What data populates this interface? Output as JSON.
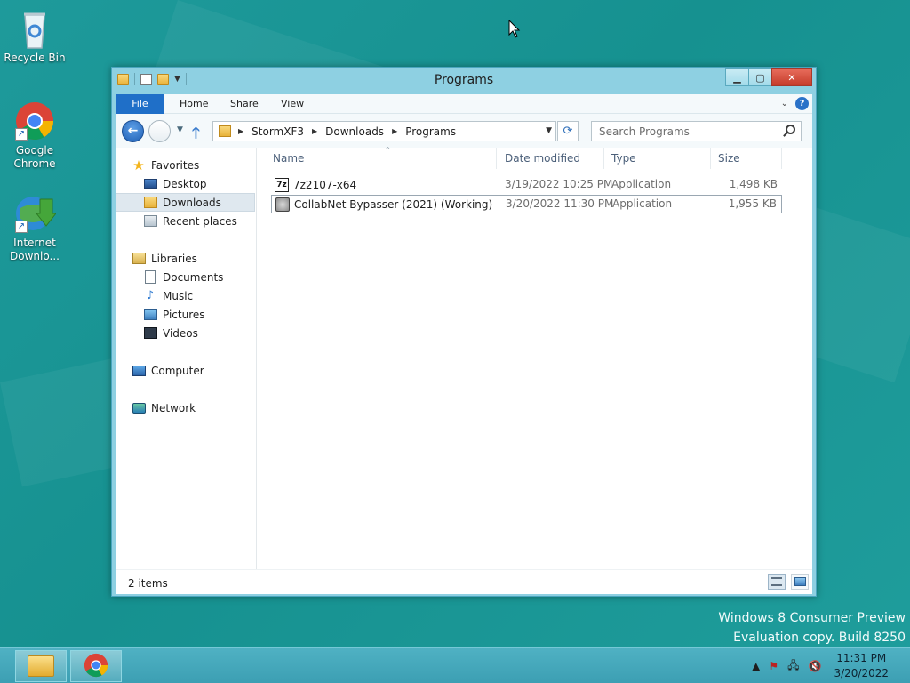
{
  "desktop": {
    "icons": [
      {
        "label": "Recycle Bin",
        "icon": "recycle-bin-icon"
      },
      {
        "label": "Google Chrome",
        "icon": "chrome-icon"
      },
      {
        "label": "Internet Downlo...",
        "icon": "internet-download-manager-icon"
      }
    ],
    "watermark_line1": "Windows 8 Consumer Preview",
    "watermark_line2": "Evaluation copy. Build 8250"
  },
  "window": {
    "title": "Programs",
    "ribbon_tabs": [
      "File",
      "Home",
      "Share",
      "View"
    ],
    "breadcrumb": [
      "StormXF3",
      "Downloads",
      "Programs"
    ],
    "search_placeholder": "Search Programs",
    "nav": {
      "favorites": {
        "label": "Favorites",
        "items": [
          "Desktop",
          "Downloads",
          "Recent places"
        ],
        "selected": "Downloads"
      },
      "libraries": {
        "label": "Libraries",
        "items": [
          "Documents",
          "Music",
          "Pictures",
          "Videos"
        ]
      },
      "computer": "Computer",
      "network": "Network"
    },
    "columns": [
      "Name",
      "Date modified",
      "Type",
      "Size"
    ],
    "files": [
      {
        "name": "7z2107-x64",
        "date": "3/19/2022 10:25 PM",
        "type": "Application",
        "size": "1,498 KB",
        "icon": "7zip-installer-icon",
        "selected": false
      },
      {
        "name": "CollabNet Bypasser (2021) (Working)",
        "date": "3/20/2022 11:30 PM",
        "type": "Application",
        "size": "1,955 KB",
        "icon": "application-icon",
        "selected": true
      }
    ],
    "status": "2 items"
  },
  "taskbar": {
    "pinned": [
      "file-explorer-icon",
      "chrome-icon"
    ],
    "time": "11:31 PM",
    "date": "3/20/2022"
  },
  "colors": {
    "desktop_bg": "#1e9a9b",
    "window_frame": "#8ed0e2",
    "file_tab": "#1f6fc8",
    "close_button": "#c53c2b"
  }
}
